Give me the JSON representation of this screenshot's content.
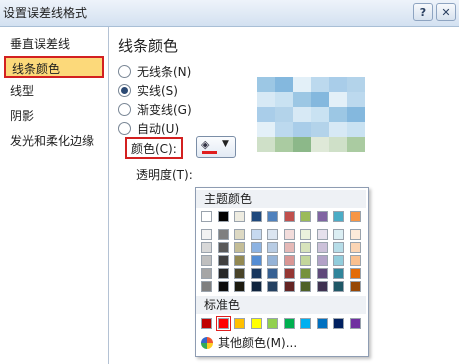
{
  "window": {
    "title": "设置误差线格式",
    "help_label": "?",
    "close_label": "✕"
  },
  "sidebar": {
    "items": [
      {
        "label": "垂直误差线",
        "selected": false
      },
      {
        "label": "线条颜色",
        "selected": true
      },
      {
        "label": "线型",
        "selected": false
      },
      {
        "label": "阴影",
        "selected": false
      },
      {
        "label": "发光和柔化边缘",
        "selected": false
      }
    ]
  },
  "main": {
    "heading": "线条颜色",
    "options": [
      {
        "label": "无线条(N)",
        "selected": false
      },
      {
        "label": "实线(S)",
        "selected": true
      },
      {
        "label": "渐变线(G)",
        "selected": false
      },
      {
        "label": "自动(U)",
        "selected": false
      }
    ],
    "color_label": "颜色(C):",
    "selected_color": "#e01e1e",
    "transparency_label": "透明度(T):"
  },
  "palette": {
    "theme_title": "主题颜色",
    "theme_top": [
      "#ffffff",
      "#000000",
      "#eeece1",
      "#1f497d",
      "#4f81bd",
      "#c0504d",
      "#9bbb59",
      "#8064a2",
      "#4bacc6",
      "#f79646"
    ],
    "theme_shades": [
      [
        "#f2f2f2",
        "#7f7f7f",
        "#ddd9c3",
        "#c6d9f0",
        "#dbe5f1",
        "#f2dcdb",
        "#ebf1dd",
        "#e5e0ec",
        "#dbeef3",
        "#fdeada"
      ],
      [
        "#d8d8d8",
        "#595959",
        "#c4bd97",
        "#8db3e2",
        "#b8cce4",
        "#e5b9b7",
        "#d7e3bc",
        "#ccc1d9",
        "#b7dde8",
        "#fbd5b5"
      ],
      [
        "#bfbfbf",
        "#3f3f3f",
        "#938953",
        "#548dd4",
        "#95b3d7",
        "#d99694",
        "#c3d69b",
        "#b2a2c7",
        "#92cddc",
        "#fac08f"
      ],
      [
        "#a5a5a5",
        "#262626",
        "#494429",
        "#17365d",
        "#366092",
        "#953734",
        "#76923c",
        "#5f497a",
        "#31859b",
        "#e36c09"
      ],
      [
        "#7f7f7f",
        "#0c0c0c",
        "#1d1b10",
        "#0f243e",
        "#244061",
        "#632423",
        "#4f6128",
        "#3f3151",
        "#205867",
        "#974806"
      ]
    ],
    "standard_title": "标准色",
    "standard": [
      "#c00000",
      "#ff0000",
      "#ffc000",
      "#ffff00",
      "#92d050",
      "#00b050",
      "#00b0f0",
      "#0070c0",
      "#002060",
      "#7030a0"
    ],
    "standard_selected_index": 1,
    "more_label": "其他颜色(M)..."
  },
  "preview_colors": [
    "#9cc7e4",
    "#bcd9ee",
    "#d7e9f5",
    "#84b8de",
    "#a9cde9",
    "#c9e2f2",
    "#e3f0f8",
    "#b3d3ea",
    "#cfe0c8",
    "#aacba1",
    "#8cb889",
    "#dfe9d8"
  ]
}
